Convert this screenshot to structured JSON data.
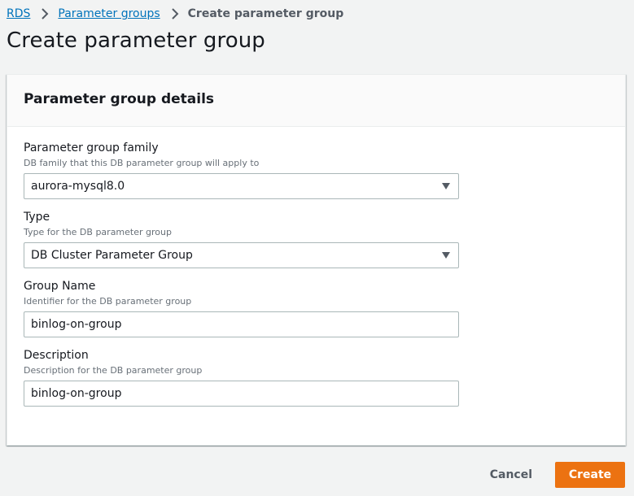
{
  "breadcrumb": {
    "items": [
      "RDS",
      "Parameter groups"
    ],
    "current": "Create parameter group"
  },
  "page": {
    "title": "Create parameter group"
  },
  "panel": {
    "title": "Parameter group details",
    "fields": [
      {
        "label": "Parameter group family",
        "description": "DB family that this DB parameter group will apply to",
        "value": "aurora-mysql8.0"
      },
      {
        "label": "Type",
        "description": "Type for the DB parameter group",
        "value": "DB Cluster Parameter Group"
      },
      {
        "label": "Group Name",
        "description": "Identifier for the DB parameter group",
        "value": "binlog-on-group"
      },
      {
        "label": "Description",
        "description": "Description for the DB parameter group",
        "value": "binlog-on-group"
      }
    ]
  },
  "footer": {
    "cancel_label": "Cancel",
    "create_label": "Create"
  },
  "colors": {
    "link": "#0073bb",
    "primary_button": "#ec7211",
    "background": "#f2f3f3"
  },
  "icons": {
    "breadcrumb_separator": "chevron-right-icon",
    "select_caret": "caret-down-icon"
  }
}
